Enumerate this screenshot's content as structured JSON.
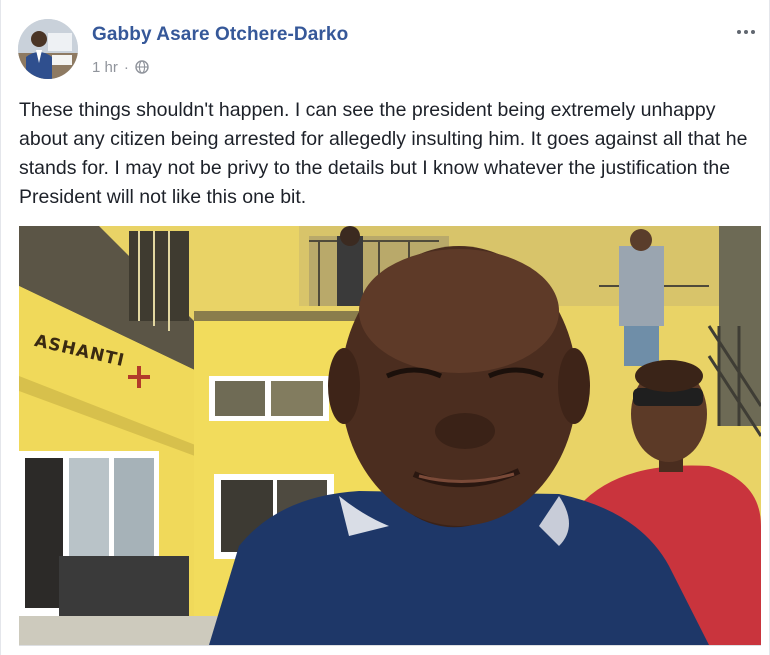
{
  "post": {
    "author": "Gabby Asare Otchere-Darko",
    "time": "1 hr",
    "separator": "·",
    "privacy_icon": "globe-icon",
    "more_icon": "ellipsis-icon",
    "text": "These things shouldn't happen. I can see the president being extremely unhappy about any citizen being arrested for allegedly insulting him. It goes against all that he stands for. I may not be privy to the details but I know whatever the justification the President will not like this one bit."
  },
  "photo": {
    "sign_text": "ASHANTI"
  },
  "colors": {
    "author_link": "#365899",
    "meta_text": "#90949c",
    "body_text": "#1d2129"
  }
}
